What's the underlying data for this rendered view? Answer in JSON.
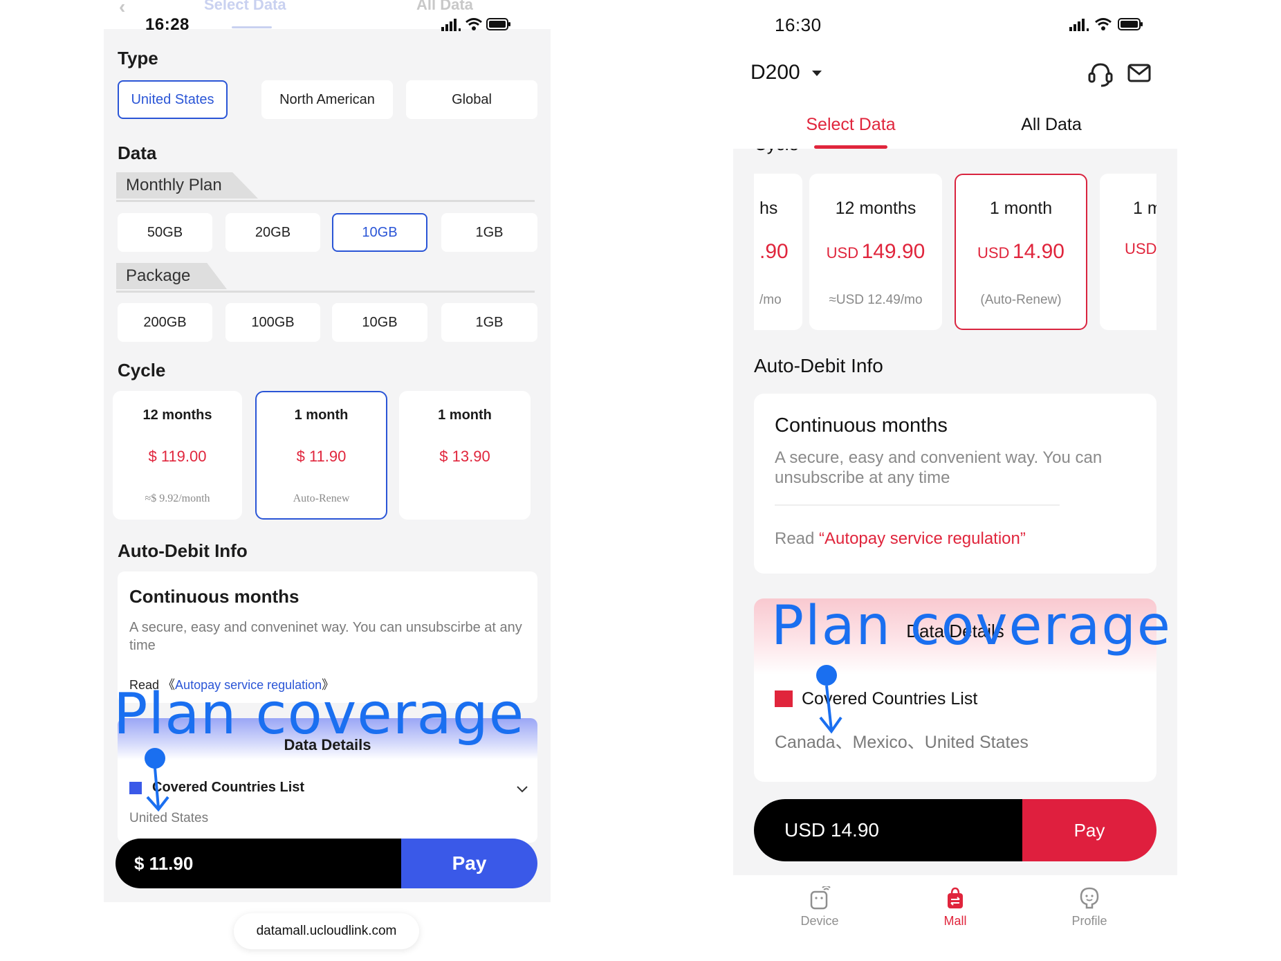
{
  "left": {
    "status": {
      "time": "16:28"
    },
    "ghost_tabs": {
      "select": "Select Data",
      "all": "All Data"
    },
    "type": {
      "title": "Type",
      "options": [
        "United States",
        "North American",
        "Global"
      ],
      "selected": "United States"
    },
    "data": {
      "title": "Data",
      "monthly_label": "Monthly Plan",
      "monthly_options": [
        "50GB",
        "20GB",
        "10GB",
        "1GB"
      ],
      "monthly_selected": "10GB",
      "package_label": "Package",
      "package_options": [
        "200GB",
        "100GB",
        "10GB",
        "1GB"
      ]
    },
    "cycle": {
      "title": "Cycle",
      "items": [
        {
          "months": "12 months",
          "price": "$ 119.00",
          "sub": "≈$ 9.92/month"
        },
        {
          "months": "1 month",
          "price": "$ 11.90",
          "sub": "Auto-Renew"
        },
        {
          "months": "1 month",
          "price": "$ 13.90",
          "sub": ""
        }
      ],
      "selected_index": 1
    },
    "auto_debit": {
      "title": "Auto-Debit Info",
      "card_title": "Continuous months",
      "desc": "A secure, easy and conveninet way. You can unsubscirbe at any time",
      "read_prefix": "Read",
      "link_open": "《",
      "link_text": "Autopay service regulation",
      "link_close": "》"
    },
    "annotation": "Plan coverage",
    "details": {
      "title": "Data Details",
      "countries_label": "Covered Countries List",
      "countries": "United States"
    },
    "pay_bar": {
      "amount": "$ 11.90",
      "pay_label": "Pay"
    },
    "url": "datamall.ucloudlink.com",
    "accent": "#2a55d6"
  },
  "right": {
    "status": {
      "time": "16:30"
    },
    "header": {
      "device": "D200"
    },
    "tabs": {
      "select": "Select Data",
      "all": "All Data",
      "active": "select"
    },
    "cycle_cards": [
      {
        "months": "",
        "cur": "",
        "price": ".90",
        "sub": "/mo",
        "partial_text_left": "hs"
      },
      {
        "months": "12 months",
        "cur": "USD",
        "price": "149.90",
        "sub": "≈USD 12.49/mo"
      },
      {
        "months": "1 month",
        "cur": "USD",
        "price": "14.90",
        "sub": "(Auto-Renew)"
      },
      {
        "months": "1 m",
        "cur": "USD",
        "price": "",
        "sub": ""
      }
    ],
    "selected_index": 2,
    "auto_debit": {
      "title": "Auto-Debit Info",
      "card_title": "Continuous months",
      "desc": "A secure, easy and convenient way. You can unsubscribe at any time",
      "read_prefix": "Read ",
      "link_text": "“Autopay service regulation”"
    },
    "annotation": "Plan coverage",
    "details": {
      "title": "Data Details",
      "countries_label": "Covered Countries List",
      "countries": "Canada、Mexico、United States"
    },
    "pay_bar": {
      "amount": "USD 14.90",
      "pay_label": "Pay"
    },
    "nav": {
      "device": "Device",
      "mall": "Mall",
      "profile": "Profile",
      "active": "mall"
    },
    "accent": "#e0253c"
  }
}
